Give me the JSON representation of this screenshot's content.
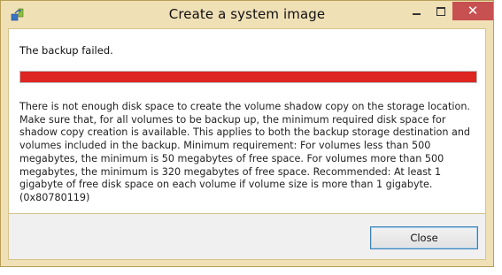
{
  "window": {
    "title": "Create a system image",
    "controls": {
      "minimize": "minimize",
      "maximize": "maximize",
      "close": "close"
    }
  },
  "dialog": {
    "status": "The backup failed.",
    "progress": {
      "percent": 100,
      "color": "#dd2522"
    },
    "message": "There is not enough disk space to create the volume shadow copy on the storage location. Make sure that, for all volumes to be backup up, the minimum required disk space for shadow copy creation is available. This applies to both the backup storage destination and volumes included in the backup. Minimum requirement: For volumes less than 500 megabytes, the minimum is 50 megabytes of free space. For volumes more than 500 megabytes, the minimum is 320 megabytes of free space.  Recommended: At least 1 gigabyte of free disk space on each volume if volume size is more than 1 gigabyte. (0x80780119)"
  },
  "buttons": {
    "close_label": "Close"
  },
  "colors": {
    "frame": "#f0e0b6",
    "close_button": "#c75050",
    "error": "#dd2522"
  },
  "icons": {
    "app": "backup-app-icon"
  }
}
